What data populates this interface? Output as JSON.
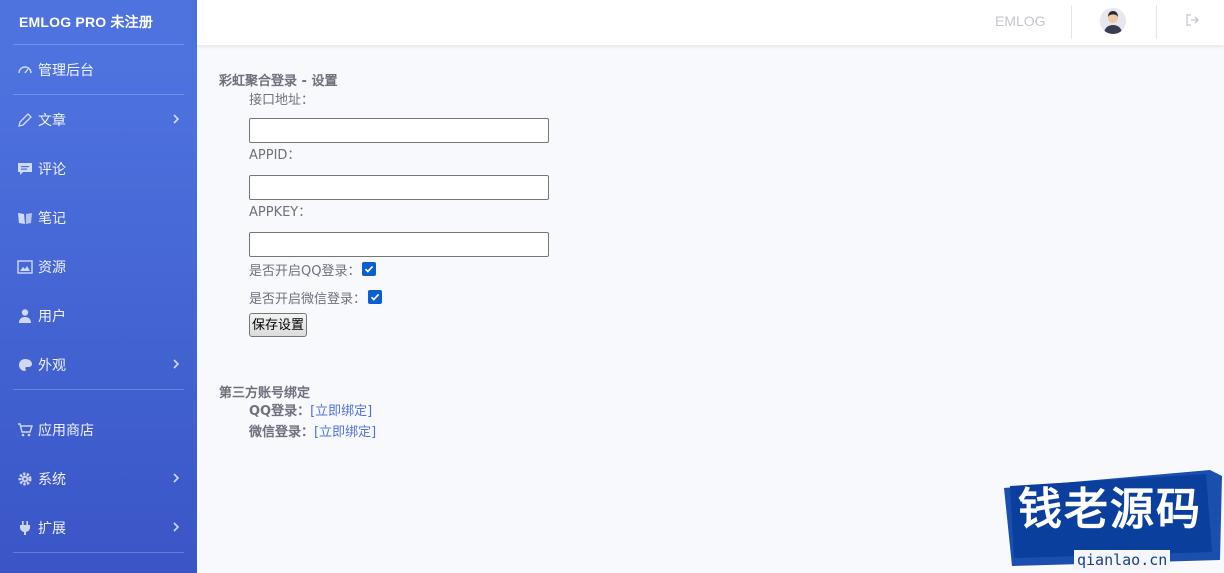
{
  "brand": {
    "title": "EMLOG PRO 未注册"
  },
  "sidebar": {
    "items": [
      {
        "label": "管理后台",
        "icon": "dashboard-icon",
        "chevron": false
      },
      {
        "label": "文章",
        "icon": "pencil-icon",
        "chevron": true
      },
      {
        "label": "评论",
        "icon": "comment-icon",
        "chevron": false
      },
      {
        "label": "笔记",
        "icon": "note-icon",
        "chevron": false
      },
      {
        "label": "资源",
        "icon": "image-icon",
        "chevron": false
      },
      {
        "label": "用户",
        "icon": "user-icon",
        "chevron": false
      },
      {
        "label": "外观",
        "icon": "palette-icon",
        "chevron": true
      },
      {
        "label": "应用商店",
        "icon": "cart-icon",
        "chevron": false
      },
      {
        "label": "系统",
        "icon": "gear-icon",
        "chevron": true
      },
      {
        "label": "扩展",
        "icon": "plug-icon",
        "chevron": true
      }
    ]
  },
  "topbar": {
    "site_name": "EMLOG"
  },
  "settings": {
    "title": "彩虹聚合登录 - 设置",
    "api_label": "接口地址：",
    "api_value": "",
    "appid_label": "APPID：",
    "appid_value": "",
    "appkey_label": "APPKEY：",
    "appkey_value": "",
    "qq_toggle_label": "是否开启QQ登录：",
    "qq_checked": true,
    "wechat_toggle_label": "是否开启微信登录：",
    "wechat_checked": true,
    "save_label": "保存设置"
  },
  "binding": {
    "title": "第三方账号绑定",
    "qq_label": "QQ登录：",
    "qq_link": "[立即绑定]",
    "wechat_label": "微信登录：",
    "wechat_link": "[立即绑定]"
  },
  "watermark": {
    "text": "钱老源码",
    "domain": "qianlao.cn"
  },
  "colors": {
    "sidebar": "#4e73df",
    "link": "#4e73df",
    "checkbox": "#0b5dd1",
    "watermark": "#0a3f9e"
  }
}
